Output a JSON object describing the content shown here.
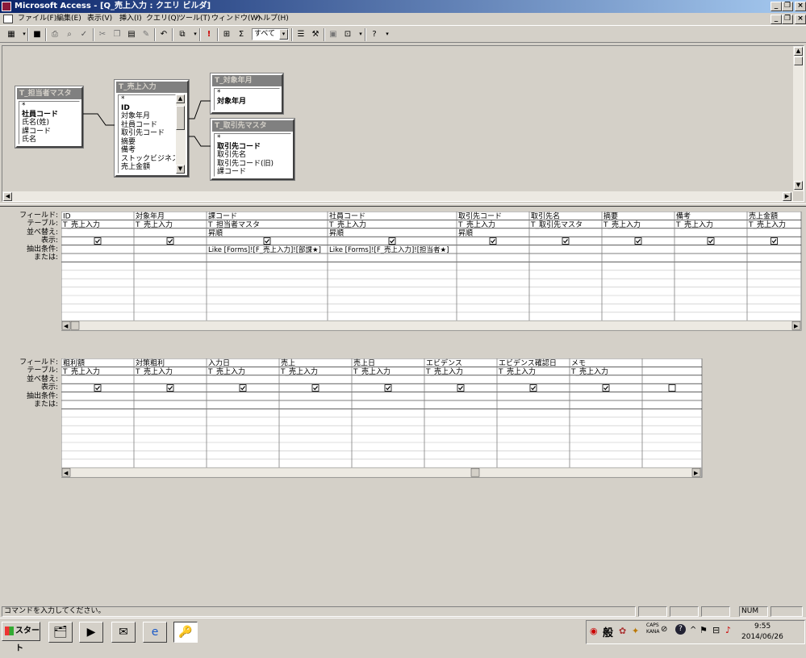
{
  "window": {
    "title": "Microsoft Access - [Q_売上入力 : クエリ ビルダ]",
    "controls": [
      "_",
      "❐",
      "×"
    ]
  },
  "child_controls": [
    "_",
    "❐",
    "×"
  ],
  "menu": [
    "ファイル(F)",
    "編集(E)",
    "表示(V)",
    "挿入(I)",
    "クエリ(Q)",
    "ツール(T)",
    "ウィンドウ(W)",
    "ヘルプ(H)"
  ],
  "toolbar": {
    "top_values": "すべて",
    "sigma": "Σ",
    "run": "!"
  },
  "tables": {
    "tanto": {
      "name": "T_担当者マスタ",
      "fields": [
        "*",
        "社員コード",
        "氏名(姓)",
        "課コード",
        "氏名"
      ],
      "bold": [
        1
      ]
    },
    "uriage": {
      "name": "T_売上入力",
      "fields": [
        "*",
        "ID",
        "対象年月",
        "社員コード",
        "取引先コード",
        "摘要",
        "備考",
        "ストックビジネス",
        "売上金額"
      ],
      "bold": [
        1
      ]
    },
    "taisho": {
      "name": "T_対象年月",
      "fields": [
        "*",
        "対象年月"
      ],
      "bold": [
        1
      ]
    },
    "torihiki": {
      "name": "T_取引先マスタ",
      "fields": [
        "*",
        "取引先コード",
        "取引先名",
        "取引先コード(旧)",
        "課コード"
      ],
      "bold": [
        1
      ]
    }
  },
  "row_labels": [
    "フィールド:",
    "テーブル:",
    "並べ替え:",
    "表示:",
    "抽出条件:",
    "または:"
  ],
  "grid1": {
    "columns": [
      {
        "field": "ID",
        "table": "T_売上入力",
        "sort": "",
        "show": true,
        "criteria": ""
      },
      {
        "field": "対象年月",
        "table": "T_売上入力",
        "sort": "",
        "show": true,
        "criteria": ""
      },
      {
        "field": "課コード",
        "table": "T_担当者マスタ",
        "sort": "昇順",
        "show": true,
        "criteria": "Like [Forms]![F_売上入力]![部課★]"
      },
      {
        "field": "社員コード",
        "table": "T_売上入力",
        "sort": "昇順",
        "show": true,
        "criteria": "Like [Forms]![F_売上入力]![担当者★]"
      },
      {
        "field": "取引先コード",
        "table": "T_売上入力",
        "sort": "昇順",
        "show": true,
        "criteria": ""
      },
      {
        "field": "取引先名",
        "table": "T_取引先マスタ",
        "sort": "",
        "show": true,
        "criteria": ""
      },
      {
        "field": "摘要",
        "table": "T_売上入力",
        "sort": "",
        "show": true,
        "criteria": ""
      },
      {
        "field": "備考",
        "table": "T_売上入力",
        "sort": "",
        "show": true,
        "criteria": ""
      },
      {
        "field": "売上金額",
        "table": "T_売上入力",
        "sort": "",
        "show": true,
        "criteria": ""
      }
    ]
  },
  "grid2": {
    "columns": [
      {
        "field": "粗利額",
        "table": "T_売上入力",
        "show": true
      },
      {
        "field": "対策粗利",
        "table": "T_売上入力",
        "show": true
      },
      {
        "field": "入力日",
        "table": "T_売上入力",
        "show": true
      },
      {
        "field": "売上",
        "table": "T_売上入力",
        "show": true
      },
      {
        "field": "売上日",
        "table": "T_売上入力",
        "show": true
      },
      {
        "field": "エビデンス",
        "table": "T_売上入力",
        "show": true
      },
      {
        "field": "エビデンス確認日",
        "table": "T_売上入力",
        "show": true
      },
      {
        "field": "メモ",
        "table": "T_売上入力",
        "show": true
      },
      {
        "field": "",
        "table": "",
        "show": false
      }
    ]
  },
  "status": {
    "message": "コマンドを入力してください。",
    "num": "NUM"
  },
  "taskbar": {
    "start": "スタート",
    "ime": "般",
    "caps": "CAPS",
    "kana": "KANA",
    "time": "9:55",
    "date": "2014/06/26"
  }
}
